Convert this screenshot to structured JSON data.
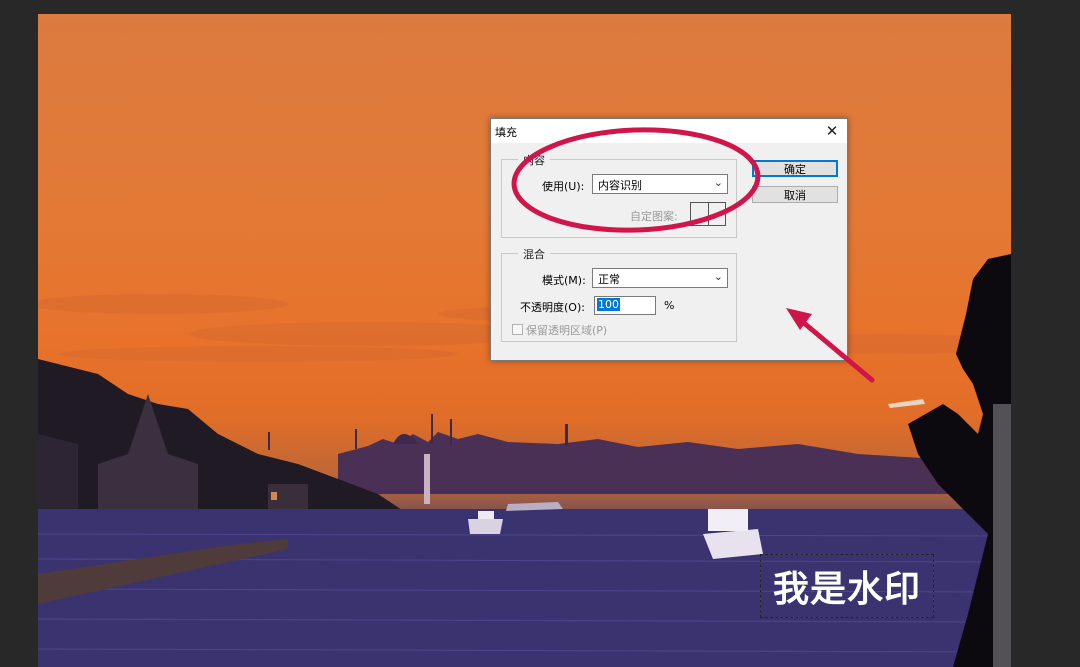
{
  "dialog": {
    "title": "填充",
    "close_glyph": "✕",
    "content_group": {
      "legend": "内容",
      "use_label": "使用(U):",
      "use_value": "内容识别",
      "custom_pattern_label": "自定图案:"
    },
    "blend_group": {
      "legend": "混合",
      "mode_label": "模式(M):",
      "mode_value": "正常",
      "opacity_label": "不透明度(O):",
      "opacity_value": "100",
      "opacity_unit": "%",
      "preserve_transparency_label": "保留透明区域(P)",
      "preserve_transparency_checked": false
    },
    "ok_label": "确定",
    "cancel_label": "取消"
  },
  "canvas": {
    "watermark_text": "我是水印"
  },
  "annotation": {
    "color": "#d0154a"
  },
  "icons": {
    "dropdown": "chevron-down-icon",
    "close": "close-icon"
  }
}
